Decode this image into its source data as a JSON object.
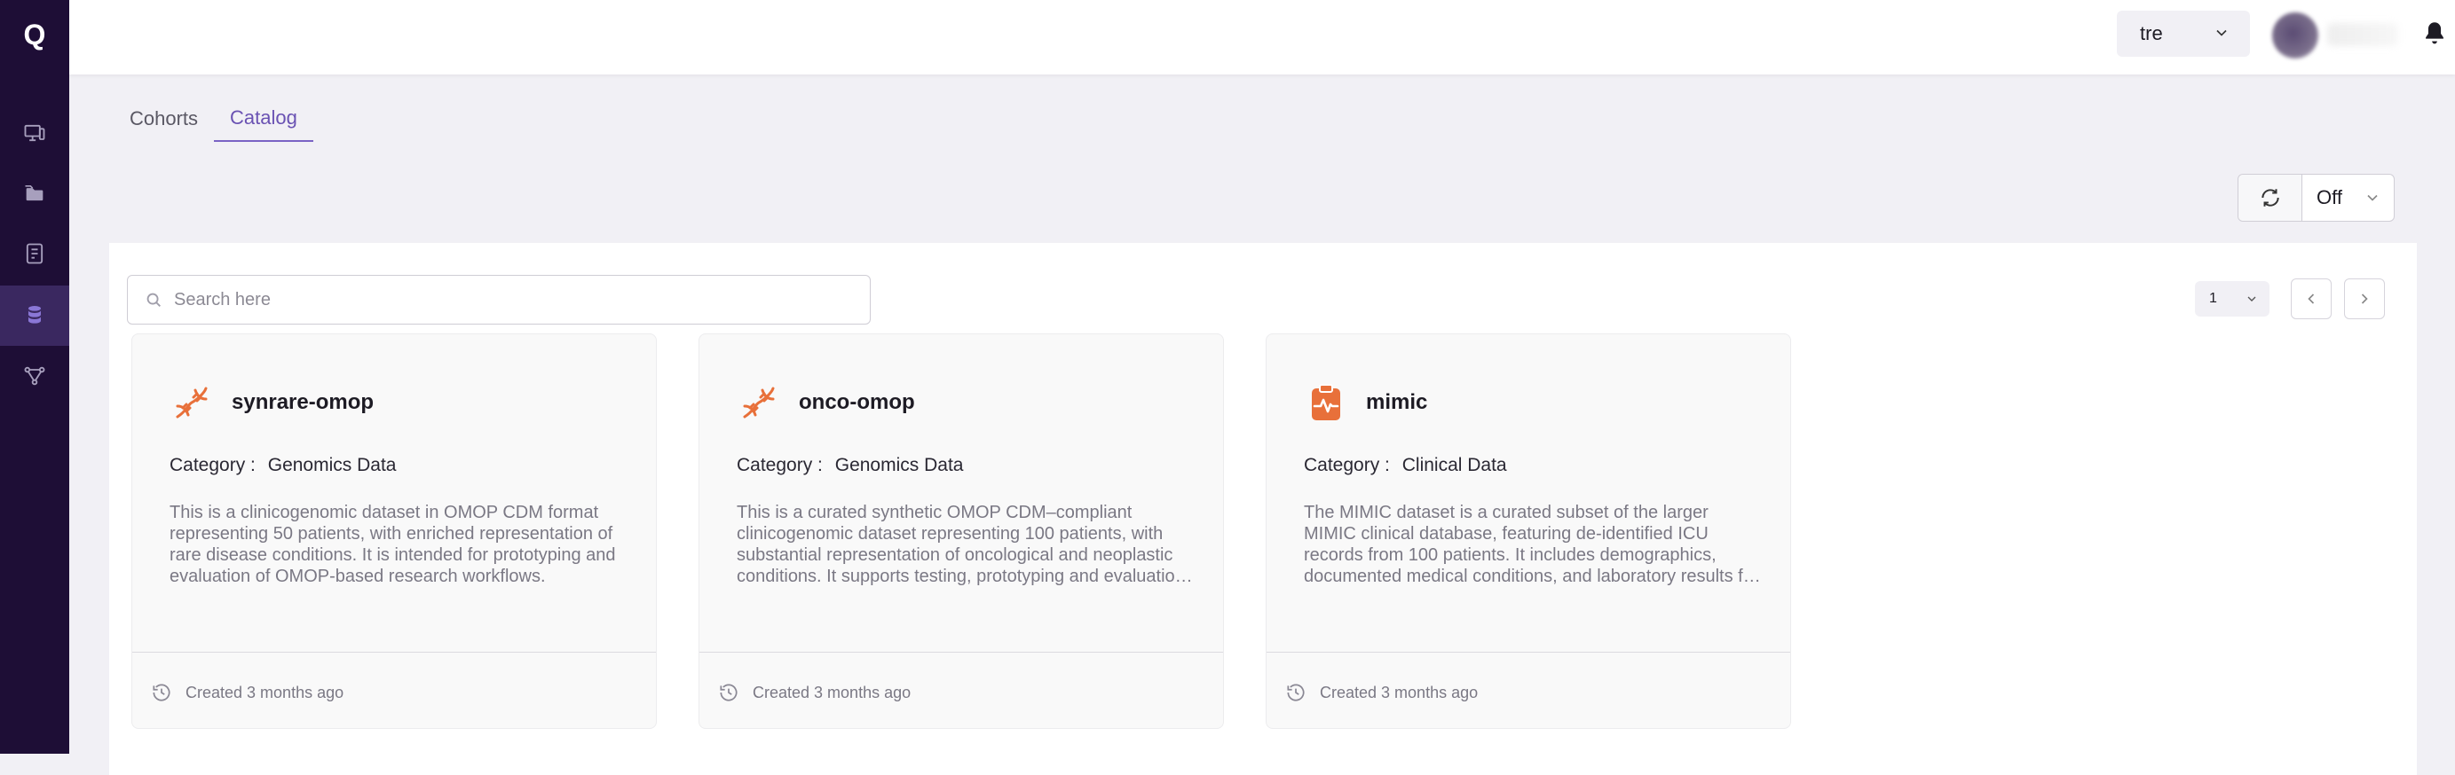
{
  "sidebar": {
    "logo": "Q",
    "items": [
      {
        "name": "monitor-icon"
      },
      {
        "name": "folder-icon"
      },
      {
        "name": "document-icon"
      },
      {
        "name": "database-icon",
        "active": true
      },
      {
        "name": "network-icon"
      }
    ]
  },
  "topbar": {
    "org_select": "tre",
    "bell_icon": "bell-icon"
  },
  "tabs": [
    {
      "label": "Cohorts",
      "active": false
    },
    {
      "label": "Catalog",
      "active": true
    }
  ],
  "refresh": {
    "icon": "refresh-icon",
    "interval": "Off"
  },
  "search": {
    "placeholder": "Search here"
  },
  "pagination": {
    "page_size": "1"
  },
  "cards": [
    {
      "title": "synrare-omop",
      "icon": "dna-icon",
      "category_label": "Category :",
      "category": "Genomics Data",
      "description": "This is a clinicogenomic dataset in OMOP CDM format representing 50 patients, with enriched representation of rare disease conditions. It is intended for prototyping and evaluation of OMOP-based research workflows.",
      "created": "Created 3 months ago"
    },
    {
      "title": "onco-omop",
      "icon": "dna-icon",
      "category_label": "Category :",
      "category": "Genomics Data",
      "description": "This is a curated synthetic OMOP CDM–compliant clinicogenomic dataset representing 100 patients, with substantial representation of oncological and neoplastic conditions. It supports testing, prototyping and evaluation of research workflows.",
      "created": "Created 3 months ago"
    },
    {
      "title": "mimic",
      "icon": "clinical-clipboard-icon",
      "category_label": "Category :",
      "category": "Clinical Data",
      "description": "The MIMIC dataset is a curated subset of the larger MIMIC clinical database, featuring de-identified ICU records from 100 patients. It includes demographics, documented medical conditions, and laboratory results for research use.",
      "created": "Created 3 months ago"
    }
  ],
  "colors": {
    "sidebar_bg": "#1e0e36",
    "accent": "#6a52b3",
    "icon_orange": "#e8703a"
  }
}
